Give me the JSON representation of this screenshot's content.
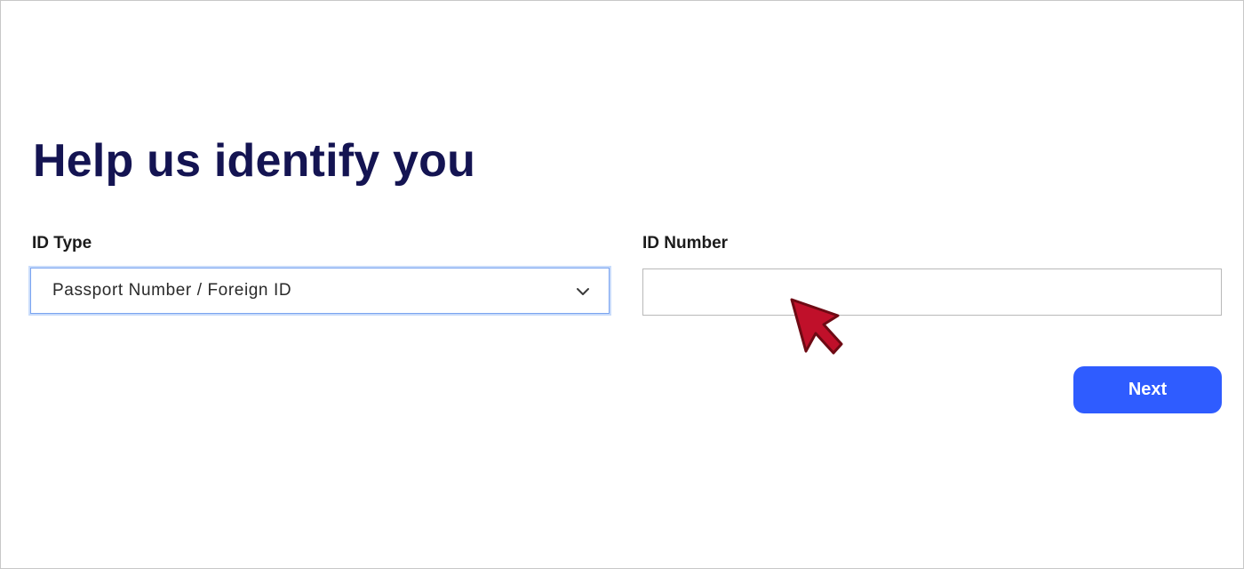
{
  "page": {
    "title": "Help us identify you"
  },
  "form": {
    "id_type": {
      "label": "ID Type",
      "selected_value": "Passport Number / Foreign ID",
      "icon": "chevron-down-icon"
    },
    "id_number": {
      "label": "ID Number",
      "value": "",
      "placeholder": ""
    },
    "next_label": "Next"
  },
  "colors": {
    "title": "#141452",
    "primary_button": "#2f5cff",
    "focus_border": "#7aa4f0",
    "cursor": "#c0102a"
  },
  "cursor": {
    "icon": "mouse-pointer-icon"
  }
}
